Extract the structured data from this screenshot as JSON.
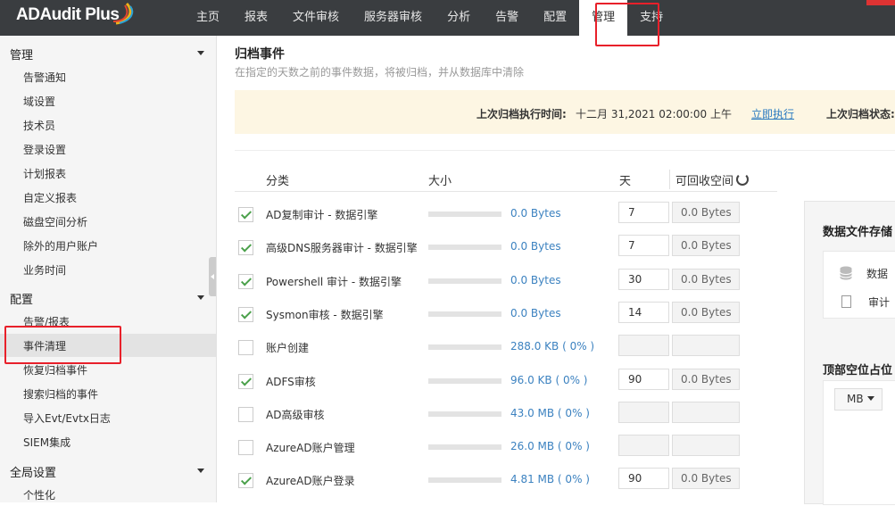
{
  "app": {
    "logo": "ADAudit Plus"
  },
  "nav": {
    "items": [
      "主页",
      "报表",
      "文件审核",
      "服务器审核",
      "分析",
      "告警",
      "配置",
      "管理",
      "支持"
    ],
    "active": "管理"
  },
  "sidebar": {
    "sections": [
      {
        "title": "管理",
        "items": [
          "告警通知",
          "域设置",
          "技术员",
          "登录设置",
          "计划报表",
          "自定义报表",
          "磁盘空间分析",
          "除外的用户账户",
          "业务时间"
        ]
      },
      {
        "title": "配置",
        "items": [
          "告警/报表",
          "事件清理",
          "恢复归档事件",
          "搜索归档的事件",
          "导入Evt/Evtx日志",
          "SIEM集成"
        ]
      },
      {
        "title": "全局设置",
        "items": [
          "个性化"
        ]
      }
    ],
    "selected": "事件清理"
  },
  "page": {
    "title": "归档事件",
    "subtitle": "在指定的天数之前的事件数据，将被归档，并从数据库中清除"
  },
  "banner": {
    "last_run_label": "上次归档执行时间:",
    "last_run_value": "十二月 31,2021 02:00:00 上午",
    "run_now": "立即执行",
    "last_status_label": "上次归档状态:"
  },
  "table": {
    "headers": {
      "category": "分类",
      "size": "大小",
      "days": "天",
      "reclaimable": "可回收空间"
    },
    "rows": [
      {
        "checked": true,
        "category": "AD复制审计 - 数据引擎",
        "size": "0.0 Bytes",
        "days": "7",
        "reclaimable": "0.0 Bytes"
      },
      {
        "checked": true,
        "category": "高级DNS服务器审计 - 数据引擎",
        "size": "0.0 Bytes",
        "days": "7",
        "reclaimable": "0.0 Bytes"
      },
      {
        "checked": true,
        "category": "Powershell 审计 - 数据引擎",
        "size": "0.0 Bytes",
        "days": "30",
        "reclaimable": "0.0 Bytes"
      },
      {
        "checked": true,
        "category": "Sysmon审核 - 数据引擎",
        "size": "0.0 Bytes",
        "days": "14",
        "reclaimable": "0.0 Bytes"
      },
      {
        "checked": false,
        "category": "账户创建",
        "size": "288.0 KB ( 0% )",
        "days": "",
        "reclaimable": ""
      },
      {
        "checked": true,
        "category": "ADFS审核",
        "size": "96.0 KB ( 0% )",
        "days": "90",
        "reclaimable": "0.0 Bytes"
      },
      {
        "checked": false,
        "category": "AD高级审核",
        "size": "43.0 MB ( 0% )",
        "days": "",
        "reclaimable": ""
      },
      {
        "checked": false,
        "category": "AzureAD账户管理",
        "size": "26.0 MB ( 0% )",
        "days": "",
        "reclaimable": ""
      },
      {
        "checked": true,
        "category": "AzureAD账户登录",
        "size": "4.81 MB ( 0% )",
        "days": "90",
        "reclaimable": "0.0 Bytes"
      }
    ]
  },
  "right_panel": {
    "title": "数据文件存储",
    "item1": "数据",
    "item2": "审计",
    "title2": "顶部空位占位",
    "unit": "MB"
  },
  "colors": {
    "topbar": "#3a3d40",
    "link": "#2a7ac0",
    "highlight": "#e8202a",
    "banner": "#fdf6e3"
  },
  "icons": [
    "refresh-icon",
    "database-icon",
    "document-icon",
    "chevron-down-icon",
    "checkmark-icon"
  ]
}
